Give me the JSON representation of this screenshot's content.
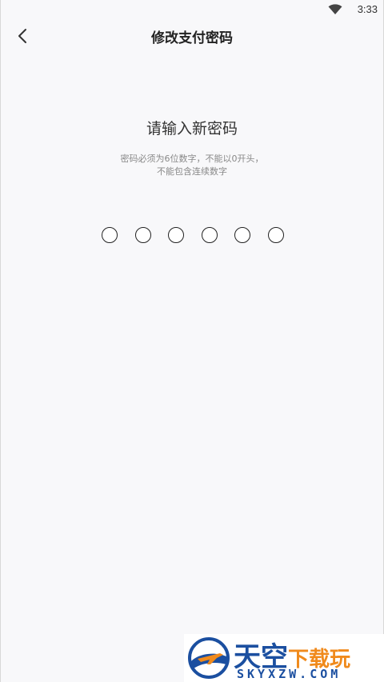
{
  "status_bar": {
    "time": "3:33",
    "wifi_icon": "wifi-icon"
  },
  "header": {
    "back_icon": "chevron-left-icon",
    "title": "修改支付密码"
  },
  "prompt": {
    "title": "请输入新密码",
    "hint_line1": "密码必须为6位数字，不能以0开头，",
    "hint_line2": "不能包含连续数字"
  },
  "pin": {
    "length": 6,
    "filled": 0
  },
  "watermark": {
    "cn_main": "天空",
    "cn_sub": "下载玩",
    "en": "SKYXZW.COM",
    "logo_icon": "airplane-logo-icon"
  },
  "colors": {
    "background": "#f8f8fa",
    "watermark_blue": "#1b4fa0",
    "watermark_orange": "#f08a1c"
  }
}
